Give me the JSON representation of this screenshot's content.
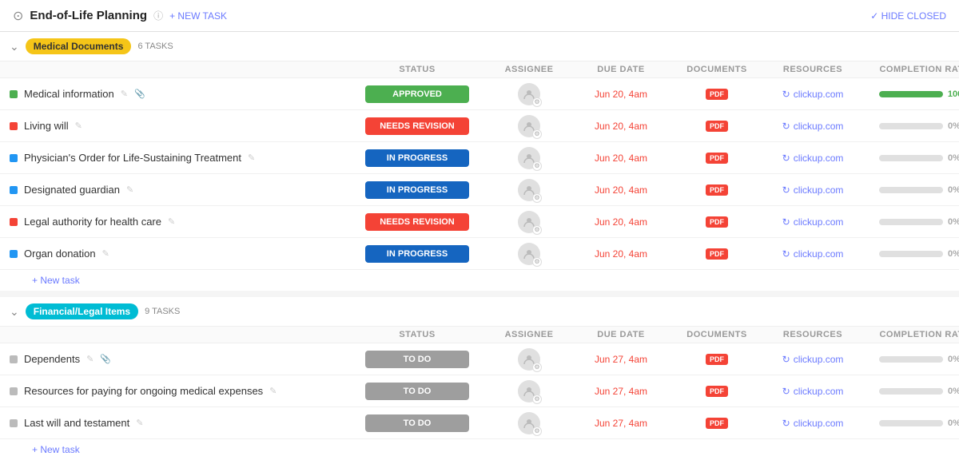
{
  "topbar": {
    "icon": "⊙",
    "title": "End-of-Life Planning",
    "new_task_label": "+ NEW TASK",
    "hide_closed_label": "✓ HIDE CLOSED"
  },
  "groups": [
    {
      "id": "medical",
      "toggle": "⌄",
      "badge_label": "Medical Documents",
      "badge_class": "badge-yellow",
      "tasks_count": "6 TASKS",
      "columns": [
        "",
        "STATUS",
        "ASSIGNEE",
        "DUE DATE",
        "DOCUMENTS",
        "RESOURCES",
        "COMPLETION RATE",
        ""
      ],
      "tasks": [
        {
          "dot": "dot-green",
          "name": "Medical information",
          "status": "APPROVED",
          "status_class": "status-approved",
          "due": "Jun 20, 4am",
          "due_overdue": true,
          "progress": 100,
          "resource_label": "clickup.com"
        },
        {
          "dot": "dot-red",
          "name": "Living will",
          "status": "NEEDS REVISION",
          "status_class": "status-needs-revision",
          "due": "Jun 20, 4am",
          "due_overdue": true,
          "progress": 0,
          "resource_label": "clickup.com"
        },
        {
          "dot": "dot-blue",
          "name": "Physician's Order for Life-Sustaining Treatment",
          "status": "IN PROGRESS",
          "status_class": "status-in-progress",
          "due": "Jun 20, 4am",
          "due_overdue": true,
          "progress": 0,
          "resource_label": "clickup.com"
        },
        {
          "dot": "dot-blue",
          "name": "Designated guardian",
          "status": "IN PROGRESS",
          "status_class": "status-in-progress",
          "due": "Jun 20, 4am",
          "due_overdue": true,
          "progress": 0,
          "resource_label": "clickup.com"
        },
        {
          "dot": "dot-red",
          "name": "Legal authority for health care",
          "status": "NEEDS REVISION",
          "status_class": "status-needs-revision",
          "due": "Jun 20, 4am",
          "due_overdue": true,
          "progress": 0,
          "resource_label": "clickup.com"
        },
        {
          "dot": "dot-blue",
          "name": "Organ donation",
          "status": "IN PROGRESS",
          "status_class": "status-in-progress",
          "due": "Jun 20, 4am",
          "due_overdue": true,
          "progress": 0,
          "resource_label": "clickup.com"
        }
      ],
      "new_task_label": "+ New task"
    },
    {
      "id": "financial",
      "toggle": "⌄",
      "badge_label": "Financial/Legal Items",
      "badge_class": "badge-teal",
      "tasks_count": "9 TASKS",
      "columns": [
        "",
        "STATUS",
        "ASSIGNEE",
        "DUE DATE",
        "DOCUMENTS",
        "RESOURCES",
        "COMPLETION RATE",
        ""
      ],
      "tasks": [
        {
          "dot": "dot-gray",
          "name": "Dependents",
          "status": "TO DO",
          "status_class": "status-todo",
          "due": "Jun 27, 4am",
          "due_overdue": true,
          "progress": 0,
          "resource_label": "clickup.com"
        },
        {
          "dot": "dot-gray",
          "name": "Resources for paying for ongoing medical expenses",
          "status": "TO DO",
          "status_class": "status-todo",
          "due": "Jun 27, 4am",
          "due_overdue": true,
          "progress": 0,
          "resource_label": "clickup.com"
        },
        {
          "dot": "dot-gray",
          "name": "Last will and testament",
          "status": "TO DO",
          "status_class": "status-todo",
          "due": "Jun 27, 4am",
          "due_overdue": true,
          "progress": 0,
          "resource_label": "clickup.com"
        }
      ],
      "new_task_label": "+ New task"
    }
  ]
}
